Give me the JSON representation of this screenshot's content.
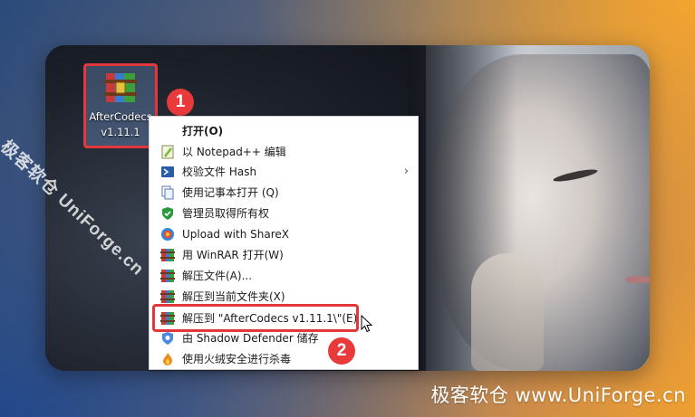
{
  "desktop_icon": {
    "name_line1": "AfterCodecs",
    "name_line2": "v1.11.1",
    "icon": "winrar-archive-icon"
  },
  "step_badges": [
    "1",
    "2"
  ],
  "context_menu": {
    "items": [
      {
        "label": "打开(O)",
        "icon": "none",
        "bold": true
      },
      {
        "label": "以 Notepad++ 编辑",
        "icon": "notepadpp-icon"
      },
      {
        "label": "校验文件 Hash",
        "icon": "powershell-icon",
        "submenu": true
      },
      {
        "label": "使用记事本打开 (Q)",
        "icon": "document-copy-icon"
      },
      {
        "label": "管理员取得所有权",
        "icon": "shield-check-icon"
      },
      {
        "label": "Upload with ShareX",
        "icon": "sharex-icon"
      },
      {
        "label": "用 WinRAR 打开(W)",
        "icon": "winrar-icon"
      },
      {
        "label": "解压文件(A)...",
        "icon": "winrar-icon"
      },
      {
        "label": "解压到当前文件夹(X)",
        "icon": "winrar-icon"
      },
      {
        "label": "解压到 \"AfterCodecs v1.11.1\\\"(E)",
        "icon": "winrar-icon",
        "highlighted": true
      },
      {
        "label": "由 Shadow Defender 储存",
        "icon": "shadow-defender-icon"
      },
      {
        "label": "使用火绒安全进行杀毒",
        "icon": "huorong-icon"
      }
    ]
  },
  "watermarks": {
    "diagonal": "极客软仓 UniForge.cn",
    "bottom": "极客软仓 www.UniForge.cn"
  },
  "colors": {
    "annotation_red": "#e0383c",
    "badge_red": "#e83a3a"
  }
}
